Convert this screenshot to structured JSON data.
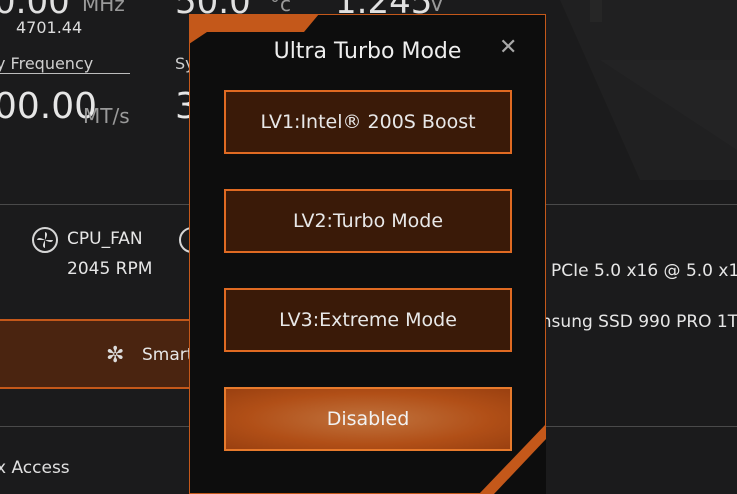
{
  "background": {
    "freq_top_label": "MHz",
    "freq_value_small": "4701.44",
    "mem_freq_label": "y Frequency",
    "mem_freq_value": "00.00",
    "mem_freq_unit": "MT/s",
    "sys_label": "Sy",
    "sys_value": "3",
    "temp_unit": "°c",
    "voltage_unit": "V",
    "top_left_big": "0.00",
    "top_mid_big": "50.0",
    "top_right_big": "1.245",
    "fans": [
      {
        "label": "CPU_FAN",
        "rpm": "2045 RPM"
      }
    ],
    "smart_button": "Smart",
    "pcie_text": "PCIe 5.0 x16  @ 5.0 x1",
    "ssd_text": "msung SSD 990 PRO 1T",
    "access_text": "x Access"
  },
  "modal": {
    "title": "Ultra Turbo Mode",
    "close": "✕",
    "options": [
      {
        "label": "LV1:Intel® 200S Boost",
        "selected": false
      },
      {
        "label": "LV2:Turbo Mode",
        "selected": false
      },
      {
        "label": "LV3:Extreme Mode",
        "selected": false
      },
      {
        "label": "Disabled",
        "selected": true
      }
    ]
  },
  "colors": {
    "accent": "#e06a22",
    "accent_dark": "#3a1a08",
    "background": "#1b1b1c"
  }
}
